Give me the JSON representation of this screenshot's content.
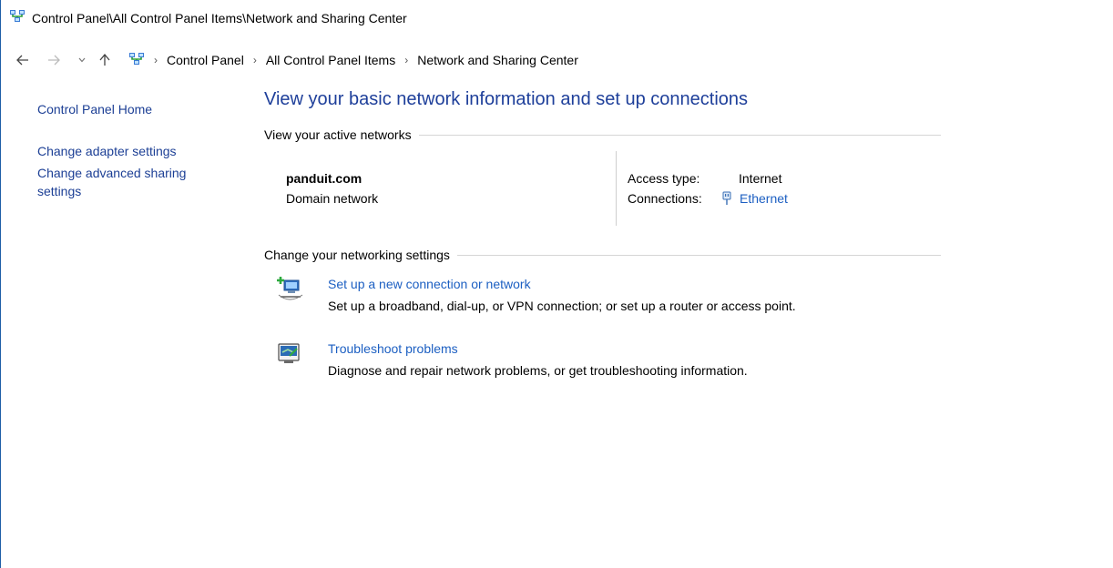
{
  "window": {
    "title": "Control Panel\\All Control Panel Items\\Network and Sharing Center"
  },
  "address_bar": {
    "breadcrumbs": [
      "Control Panel",
      "All Control Panel Items",
      "Network and Sharing Center"
    ]
  },
  "left_pane": {
    "home_label": "Control Panel Home",
    "adapter_label": "Change adapter settings",
    "advanced_sharing_label": "Change advanced sharing settings"
  },
  "main": {
    "title": "View your basic network information and set up connections",
    "active_networks": {
      "heading": "View your active networks",
      "network_name": "panduit.com",
      "network_type": "Domain network",
      "access_type_label": "Access type:",
      "access_type_value": "Internet",
      "connections_label": "Connections:",
      "connections_value": "Ethernet",
      "connection_icon": "ethernet-plug-icon"
    },
    "networking_settings": {
      "heading": "Change your networking settings",
      "tasks": [
        {
          "icon": "new-connection-icon",
          "link": "Set up a new connection or network",
          "description": "Set up a broadband, dial-up, or VPN connection; or set up a router or access point."
        },
        {
          "icon": "troubleshoot-icon",
          "link": "Troubleshoot problems",
          "description": "Diagnose and repair network problems, or get troubleshooting information."
        }
      ]
    }
  },
  "colors": {
    "link_blue": "#1c5fc2",
    "title_blue": "#1e3f9a",
    "nav_link_blue": "#1c3f95",
    "divider_gray": "#d6d6d6"
  }
}
